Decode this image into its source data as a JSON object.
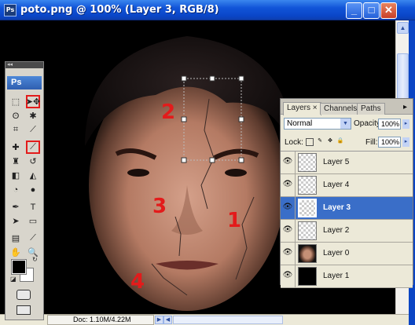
{
  "window": {
    "title": "poto.png @ 100% (Layer 3, RGB/8)",
    "app_icon_text": "Ps",
    "buttons": {
      "minimize": "_",
      "maximize": "□",
      "close": "✕"
    }
  },
  "status_bar": {
    "doc_info": "Doc: 1.10M/4.22M"
  },
  "toolbox": {
    "collapse": "◂◂",
    "logo": "Ps",
    "tools": [
      {
        "name": "rectangular-marquee-icon",
        "glyph": "⬚"
      },
      {
        "name": "move-icon",
        "glyph": "➤✥",
        "highlighted": true
      },
      {
        "name": "lasso-icon",
        "glyph": "ʘ"
      },
      {
        "name": "magic-wand-icon",
        "glyph": "✱"
      },
      {
        "name": "crop-icon",
        "glyph": "⌗"
      },
      {
        "name": "slice-icon",
        "glyph": "⟋"
      },
      {
        "name": "healing-brush-icon",
        "glyph": "✚"
      },
      {
        "name": "brush-icon",
        "glyph": "⟋",
        "highlighted": true
      },
      {
        "name": "clone-stamp-icon",
        "glyph": "♜"
      },
      {
        "name": "history-brush-icon",
        "glyph": "↺"
      },
      {
        "name": "eraser-icon",
        "glyph": "◧"
      },
      {
        "name": "paint-bucket-icon",
        "glyph": "◭"
      },
      {
        "name": "blur-icon",
        "glyph": "◔"
      },
      {
        "name": "dodge-icon",
        "glyph": "●"
      },
      {
        "name": "pen-icon",
        "glyph": "✒"
      },
      {
        "name": "type-icon",
        "glyph": "T"
      },
      {
        "name": "path-selection-icon",
        "glyph": "➤"
      },
      {
        "name": "rectangle-shape-icon",
        "glyph": "▭"
      },
      {
        "name": "notes-icon",
        "glyph": "▤"
      },
      {
        "name": "eyedropper-icon",
        "glyph": "⟋"
      },
      {
        "name": "hand-icon",
        "glyph": "✋"
      },
      {
        "name": "zoom-icon",
        "glyph": "🔍"
      }
    ]
  },
  "annotations": [
    "1",
    "2",
    "3",
    "4"
  ],
  "layers_panel": {
    "tabs": [
      "Layers",
      "Channels",
      "Paths"
    ],
    "tab_close": "×",
    "blend_mode": "Normal",
    "opacity_label": "Opacity:",
    "opacity_value": "100%",
    "lock_label": "Lock:",
    "fill_label": "Fill:",
    "fill_value": "100%",
    "menu_arrow": "▸",
    "layers": [
      {
        "name": "Layer 5",
        "thumb": "transparent",
        "selected": false
      },
      {
        "name": "Layer 4",
        "thumb": "transparent",
        "selected": false
      },
      {
        "name": "Layer 3",
        "thumb": "transparent",
        "selected": true
      },
      {
        "name": "Layer 2",
        "thumb": "transparent",
        "selected": false
      },
      {
        "name": "Layer 0",
        "thumb": "photo",
        "selected": false
      },
      {
        "name": "Layer 1",
        "thumb": "black",
        "selected": false
      }
    ]
  },
  "colors": {
    "selected_layer": "#3a6ec8",
    "annotation_red": "#e31b1b",
    "xp_title_blue": "#0a46c8"
  }
}
